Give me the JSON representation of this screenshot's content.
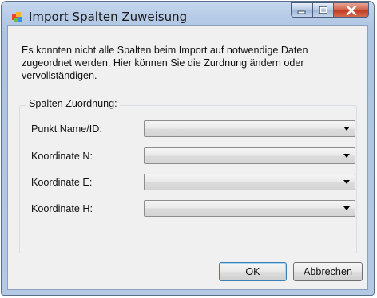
{
  "window": {
    "title": "Import Spalten Zuweisung"
  },
  "message": "Es konnten nicht alle Spalten beim Import auf notwendige Daten zugeordnet werden. Hier können Sie die Zurdnung ändern oder vervollständigen.",
  "group": {
    "label": "Spalten Zuordnung:",
    "rows": [
      {
        "label": "Punkt Name/ID:",
        "value": ""
      },
      {
        "label": "Koordinate N:",
        "value": ""
      },
      {
        "label": "Koordinate E:",
        "value": ""
      },
      {
        "label": "Koordinate H:",
        "value": ""
      }
    ]
  },
  "buttons": {
    "ok": "OK",
    "cancel": "Abbrechen"
  },
  "colors": {
    "title_bar": "#b6cbe6",
    "dialog_bg": "#f0f0f0",
    "close_button": "#c0391f",
    "default_button_border": "#3c7fb1"
  }
}
